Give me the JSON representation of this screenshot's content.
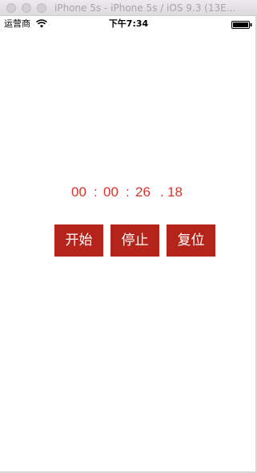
{
  "window": {
    "title": "iPhone 5s - iPhone 5s / iOS 9.3 (13E..."
  },
  "statusbar": {
    "carrier": "运营商",
    "time": "下午7:34",
    "wifi_icon": "wifi-icon",
    "battery_icon": "battery-full-icon"
  },
  "timer": {
    "hours": "00",
    "sep1": ":",
    "minutes": "00",
    "sep2": ":",
    "seconds": "26",
    "sep3": ".",
    "centiseconds": "18",
    "color": "#d9342b"
  },
  "buttons": {
    "start_label": "开始",
    "stop_label": "停止",
    "reset_label": "复位",
    "background": "#b5241b",
    "text_color": "#ffffff"
  }
}
